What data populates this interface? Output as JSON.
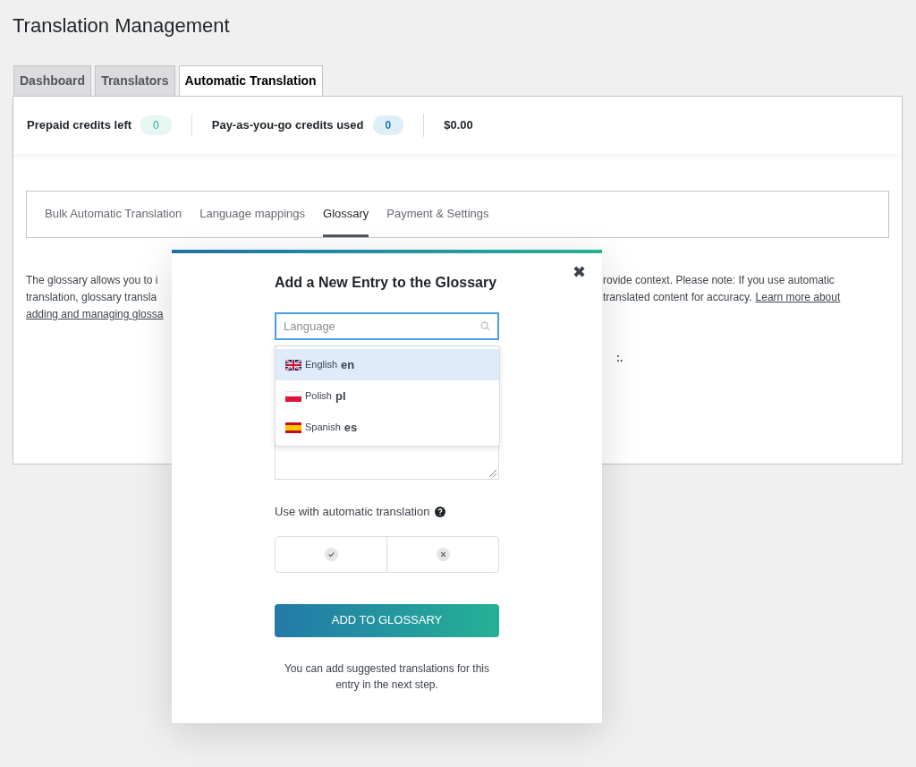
{
  "page_title": "Translation Management",
  "tabs": [
    {
      "label": "Dashboard",
      "selected": false
    },
    {
      "label": "Translators",
      "selected": false
    },
    {
      "label": "Automatic Translation",
      "selected": true
    }
  ],
  "credits": [
    {
      "label": "Prepaid credits left",
      "value": "0",
      "color": "#e6f6f3"
    },
    {
      "label": "Pay-as-you-go credits used",
      "value": "0",
      "color": "#deeef6"
    }
  ],
  "amount": "$0.00",
  "subtabs": [
    {
      "label": "Bulk Automatic Translation",
      "selected": false
    },
    {
      "label": "Language mappings",
      "selected": false
    },
    {
      "label": "Glossary",
      "selected": true
    },
    {
      "label": "Payment & Settings",
      "selected": false
    }
  ],
  "background_text": {
    "lines": [
      {
        "left": "The glossary allows you to i",
        "right": "rovide context. Please note: If you use automatic"
      },
      {
        "left": "translation, glossary transla",
        "right": "translated content for accuracy.",
        "right_link": "Learn more about"
      },
      {
        "left_link": "adding and managing glossa"
      }
    ],
    "fragment": ":."
  },
  "modal": {
    "title": "Add a New Entry to the Glossary",
    "close": "✖",
    "language_field": {
      "placeholder": "Language"
    },
    "dropdown": [
      {
        "name": "English",
        "code": "en",
        "selected": true
      },
      {
        "name": "Polish",
        "code": "pl",
        "selected": false
      },
      {
        "name": "Spanish",
        "code": "es",
        "selected": false
      }
    ],
    "auto_label": "Use with automatic translation",
    "submit": "ADD TO GLOSSARY",
    "note": "You can add suggested translations for this entry in the next step."
  }
}
